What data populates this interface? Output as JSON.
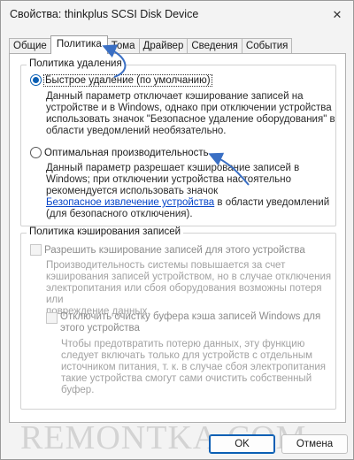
{
  "window": {
    "title": "Свойства:  thinkplus SCSI Disk Device",
    "close_glyph": "✕"
  },
  "tabs": [
    {
      "label": "Общие"
    },
    {
      "label": "Политика"
    },
    {
      "label": "Тома"
    },
    {
      "label": "Драйвер"
    },
    {
      "label": "Сведения"
    },
    {
      "label": "События"
    }
  ],
  "removal_group": {
    "title": "Политика удаления",
    "quick_removal": {
      "label": "Быстрое удаление (по умолчанию)",
      "checked": true,
      "desc_lines": [
        "Данный параметр отключает кэширование записей на",
        "устройстве и в Windows, однако при отключении устройства",
        "использовать значок \"Безопасное удаление оборудования\" в",
        "области уведомлений необязательно."
      ]
    },
    "better_performance": {
      "label": "Оптимальная производительность",
      "checked": false,
      "desc_lines": [
        "Данный параметр разрешает кэширование записей в",
        "Windows; при отключении устройства настоятельно",
        "рекомендуется использовать значок"
      ],
      "link_text": "Безопасное извлечение устройства",
      "link_suffix": " в области уведомлений",
      "desc_last": "(для безопасного отключения)."
    }
  },
  "cache_group": {
    "title": "Политика кэширования записей",
    "enable_cache": {
      "label": "Разрешить кэширование записей для этого устройства",
      "checked": false,
      "desc_lines": [
        "Производительность системы повышается за счет",
        "кэширования записей устройством, но в случае отключения",
        "электропитания или сбоя оборудования возможны потеря или",
        "повреждение данных."
      ]
    },
    "flush_off": {
      "label_line1": "Отключить очистку буфера кэша записей Windows для",
      "label_line2": "этого устройства",
      "checked": false,
      "desc_lines": [
        "Чтобы предотвратить потерю данных, эту функцию",
        "следует включать только для устройств с отдельным",
        "источником питания, т. к.  в случае сбоя электропитания",
        "такие устройства смогут сами очистить собственный",
        "буфер."
      ]
    }
  },
  "buttons": {
    "ok": "OK",
    "cancel": "Отмена"
  },
  "watermark": "REMONTKA.COM",
  "colors": {
    "accent": "#0a5fb4",
    "link": "#0645c8",
    "annotation_arrow": "#3a6fc4"
  }
}
